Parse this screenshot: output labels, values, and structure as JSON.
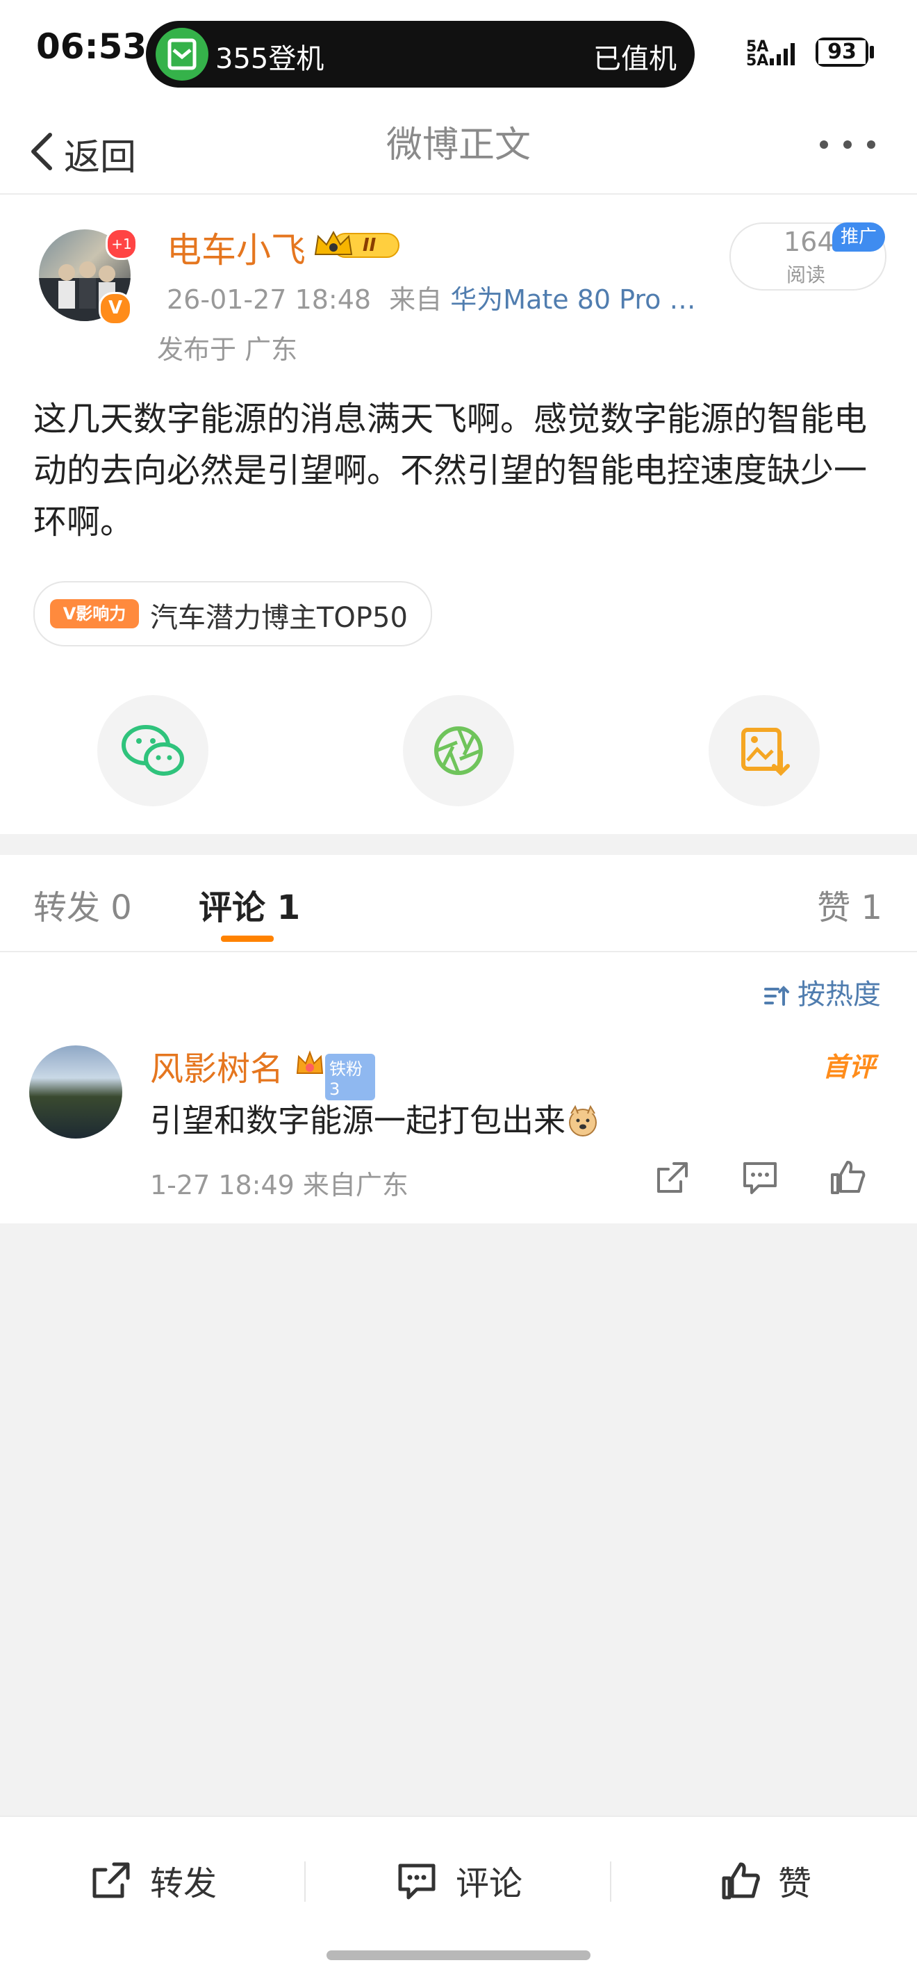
{
  "status_bar": {
    "time": "06:53",
    "island_left": "355登机",
    "island_right": "已值机",
    "signal": "5A\n5A",
    "battery": "93"
  },
  "nav": {
    "back_label": "返回",
    "title": "微博正文"
  },
  "post": {
    "author": "电车小飞",
    "avatar_badge": "+1",
    "verify_badge": "V",
    "crown_badge_text": "II",
    "meta_time": "26-01-27 18:48",
    "meta_from": "来自",
    "meta_device": "华为Mate 80 Pro …",
    "location": "发布于 广东",
    "read_count": "164",
    "read_label": "阅读",
    "promo_badge": "推广",
    "text": "这几天数字能源的消息满天飞啊。感觉数字能源的智能电动的去向必然是引望啊。不然引望的智能电控速度缺少一环啊。",
    "influence_badge": "V影响力",
    "influence_label": "汽车潜力博主TOP50"
  },
  "tabs": {
    "repost": "转发 0",
    "comments": "评论 1",
    "likes": "赞 1"
  },
  "comments": {
    "sort_label": "按热度",
    "items": [
      {
        "user": "风影树名",
        "fan_badge": "铁粉3",
        "first_badge": "首评",
        "text": "引望和数字能源一起打包出来",
        "meta": "1-27 18:49 来自广东"
      }
    ]
  },
  "bottom_bar": {
    "repost": "转发",
    "comment": "评论",
    "like": "赞"
  },
  "colors": {
    "accent_orange": "#ff8200",
    "name_orange": "#e5761f",
    "link_blue": "#507daf",
    "wechat_green": "#2fc37c",
    "moments_green": "#6fc45b",
    "save_orange": "#f5a623"
  }
}
